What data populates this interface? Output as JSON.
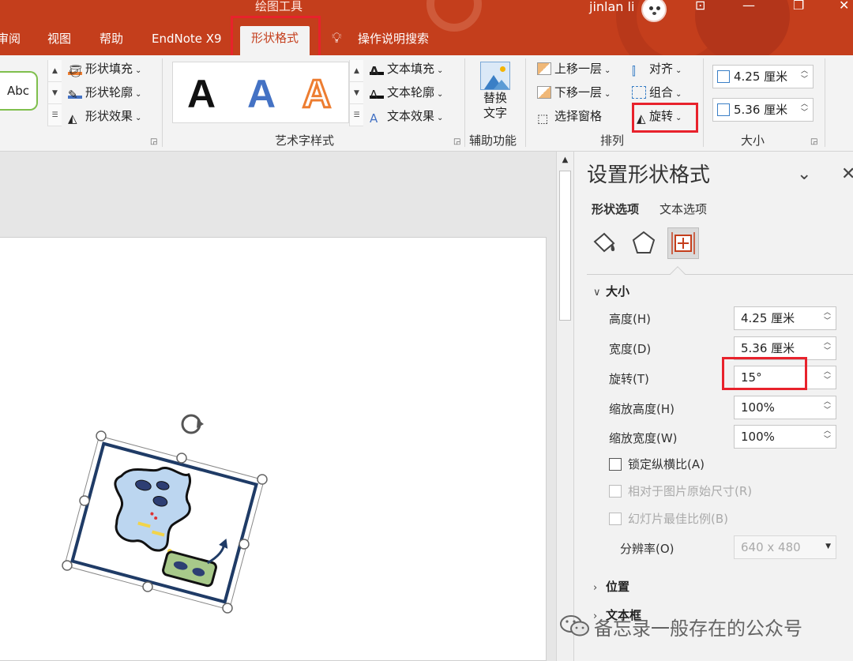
{
  "titlebar": {
    "context_tool_label": "绘图工具",
    "user_name": "jinlan li",
    "tabs": [
      {
        "label": "审阅"
      },
      {
        "label": "视图"
      },
      {
        "label": "帮助"
      },
      {
        "label": "EndNote X9"
      },
      {
        "label": "形状格式"
      },
      {
        "label": "操作说明搜索"
      }
    ]
  },
  "ribbon": {
    "shape_styles": {
      "preview": "Abc",
      "fill": "形状填充",
      "outline": "形状轮廓",
      "effects": "形状效果"
    },
    "wordart": {
      "letters": [
        "A",
        "A",
        "A"
      ],
      "text_fill": "文本填充",
      "text_outline": "文本轮廓",
      "text_effects": "文本效果",
      "group_label": "艺术字样式"
    },
    "accessibility": {
      "alt_text_line1": "替换",
      "alt_text_line2": "文字",
      "group_label": "辅助功能"
    },
    "arrange": {
      "bring_forward": "上移一层",
      "send_backward": "下移一层",
      "selection_pane": "选择窗格",
      "align": "对齐",
      "group": "组合",
      "rotate": "旋转",
      "group_label": "排列"
    },
    "size": {
      "height": "4.25 厘米",
      "width": "5.36 厘米",
      "group_label": "大小"
    }
  },
  "pane": {
    "title": "设置形状格式",
    "tabs": {
      "shape_options": "形状选项",
      "text_options": "文本选项"
    },
    "size_section": {
      "title": "大小",
      "height_label": "高度(H)",
      "height_value": "4.25 厘米",
      "width_label": "宽度(D)",
      "width_value": "5.36 厘米",
      "rotation_label": "旋转(T)",
      "rotation_value": "15°",
      "scale_height_label": "缩放高度(H)",
      "scale_height_value": "100%",
      "scale_width_label": "缩放宽度(W)",
      "scale_width_value": "100%",
      "lock_aspect_label": "锁定纵横比(A)",
      "relative_original_label": "相对于图片原始尺寸(R)",
      "best_scale_label": "幻灯片最佳比例(B)",
      "resolution_label": "分辨率(O)",
      "resolution_value": "640 x 480"
    },
    "position_section": {
      "title": "位置"
    },
    "textbox_section": {
      "title": "文本框"
    }
  },
  "watermark": {
    "text": "备忘录一般存在的公众号"
  },
  "colors": {
    "accent": "#c43e1c",
    "highlight_box": "#e8222c",
    "wordart_black": "#111111",
    "wordart_blue": "#4472c4",
    "wordart_orange": "#ed7d31"
  }
}
